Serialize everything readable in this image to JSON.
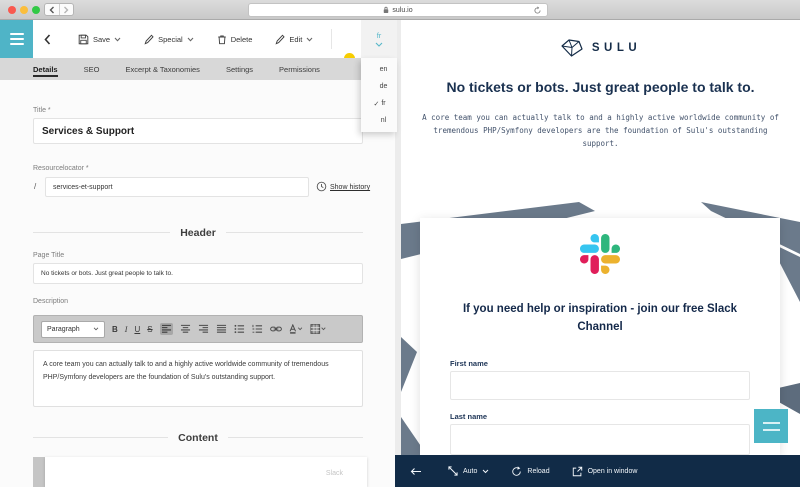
{
  "browser": {
    "url": "sulu.io"
  },
  "admin_toolbar": {
    "save": "Save",
    "special": "Special",
    "delete": "Delete",
    "edit": "Edit"
  },
  "language": {
    "current": "fr",
    "options": [
      {
        "label": "en",
        "check": ""
      },
      {
        "label": "de",
        "check": ""
      },
      {
        "label": "fr",
        "check": "✓"
      },
      {
        "label": "nl",
        "check": ""
      }
    ]
  },
  "tabs": [
    {
      "label": "Details"
    },
    {
      "label": "SEO"
    },
    {
      "label": "Excerpt & Taxonomies"
    },
    {
      "label": "Settings"
    },
    {
      "label": "Permissions"
    }
  ],
  "form": {
    "title": {
      "label": "Title *",
      "value": "Services & Support"
    },
    "resourcelocator": {
      "label": "Resourcelocator *",
      "prefix": "/",
      "value": "services-et-support",
      "history_link": "Show history"
    },
    "sections": {
      "header": "Header",
      "content": "Content"
    },
    "page_title": {
      "label": "Page Title",
      "value": "No tickets or bots. Just great people to talk to."
    },
    "description": {
      "label": "Description",
      "value": "A core team you can actually talk to and a highly active worldwide community of tremendous PHP/Symfony developers are the foundation of Sulu's outstanding support.",
      "toolbar": {
        "style": "Paragraph",
        "bold": "B",
        "italic": "I",
        "underline": "U",
        "strikethrough": "S"
      }
    },
    "content_block": {
      "type_label": "Slack"
    }
  },
  "preview": {
    "logo": "SULU",
    "heading": "No tickets or bots. Just great people to talk to.",
    "body": "A core team you can actually talk to and a highly active worldwide community of tremendous PHP/Symfony developers are the foundation of Sulu's outstanding support.",
    "slack_card": {
      "heading": "If you need help or inspiration - join our free Slack Channel",
      "fields": [
        {
          "label": "First name",
          "value": ""
        },
        {
          "label": "Last name",
          "value": ""
        }
      ]
    },
    "toolbar": {
      "mode": "Auto",
      "reload": "Reload",
      "open": "Open in window"
    }
  },
  "colors": {
    "accent_teal": "#4fb4c7",
    "status_yellow": "#f7cd00",
    "navy": "#112b47",
    "slate": "#6b7a8b",
    "slack_blue": "#36C5F0",
    "slack_green": "#2EB67D",
    "slack_yellow": "#ECB22E",
    "slack_red": "#E01E5A"
  }
}
